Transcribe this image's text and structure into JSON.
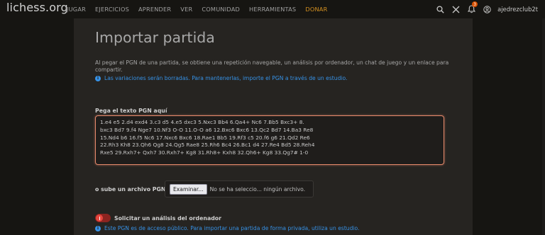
{
  "header": {
    "logo": "lichess.org",
    "nav": [
      {
        "label": "Jugar"
      },
      {
        "label": "Ejercicios"
      },
      {
        "label": "Aprender"
      },
      {
        "label": "Ver"
      },
      {
        "label": "Comunidad"
      },
      {
        "label": "Herramientas"
      },
      {
        "label": "Donar"
      }
    ],
    "notification_count": "3",
    "username": "ajedrezclub2t",
    "icons": [
      "search-icon",
      "close-icon",
      "bell-icon",
      "user-circle-icon"
    ]
  },
  "page": {
    "title": "Importar partida",
    "description": "Al pegar el PGN de una partida, se obtiene una repetición navegable, un análisis por ordenador, un chat de juego y un enlace para compartir.",
    "variations_notice": "Las variaciones serán borradas. Para mantenerlas, importe el PGN a través de un estudio.",
    "pgn_label": "Pega el texto PGN aquí",
    "pgn_text": "1.e4 e5 2.d4 exd4 3.c3 d5 4.e5 dxc3 5.Nxc3 Bb4 6.Qa4+ Nc6 7.Bb5 Bxc3+ 8.\nbxc3 Bd7 9.f4 Nge7 10.Nf3 O-O 11.O-O a6 12.Bxc6 Bxc6 13.Qc2 Bd7 14.Ba3 Re8\n15.Nd4 b6 16.f5 Nc6 17.Nxc6 Bxc6 18.Rae1 Bb5 19.Rf3 c5 20.f6 g6 21.Qd2 Re6\n22.Rh3 Kh8 23.Qh6 Qg8 24.Qg5 Rae8 25.Rh6 Bc4 26.Bc1 d4 27.Re4 Bd5 28.Reh4\nRxe5 29.Rxh7+ Qxh7 30.Rxh7+ Kg8 31.Rh8+ Kxh8 32.Qh6+ Kg8 33.Qg7# 1-0",
    "file_label": "o sube un archivo PGN",
    "file_button": "Examinar...",
    "file_status": "No se ha seleccio... ningún archivo.",
    "analysis_label": "Solicitar un análisis del ordenador",
    "analysis_enabled": false,
    "public_notice": "Este PGN es de acceso público. Para importar una partida de forma privada, utiliza un estudio."
  },
  "colors": {
    "background": "#161512",
    "panel": "#262421",
    "accent_link": "#3692e7",
    "donate": "#d59120",
    "focus_border": "#e5896b",
    "toggle_off": "#e6463e"
  }
}
